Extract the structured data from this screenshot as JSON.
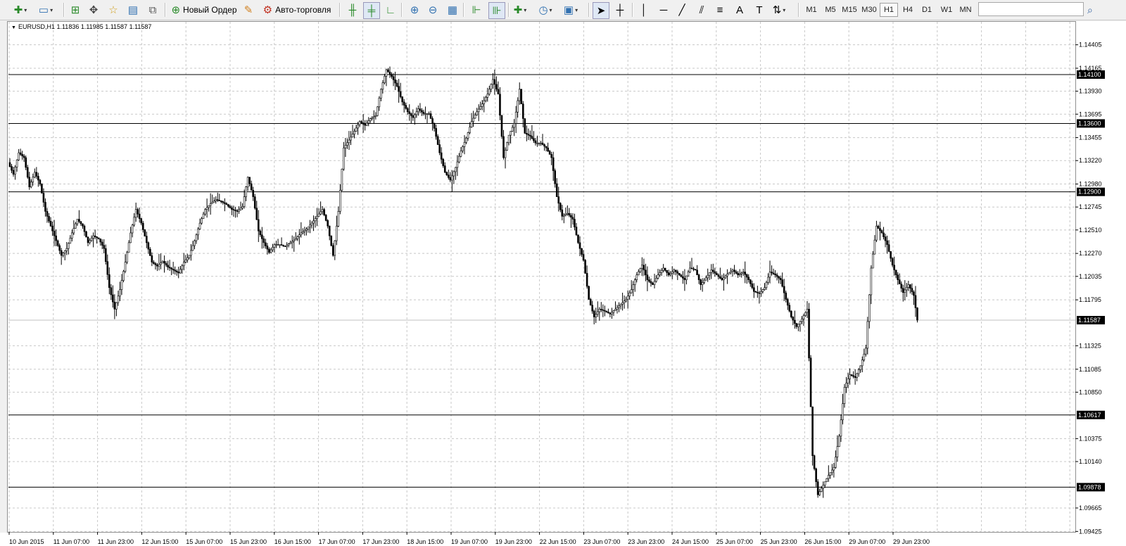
{
  "toolbar": {
    "new_order_label": "Новый Ордер",
    "autotrading_label": "Авто-торговля",
    "timeframes": [
      "M1",
      "M5",
      "M15",
      "M30",
      "H1",
      "H4",
      "D1",
      "W1",
      "MN"
    ],
    "active_timeframe": "H1",
    "search_placeholder": ""
  },
  "chart_header": {
    "symbol": "EURUSD,H1",
    "ohlc": "1.11836 1.11985 1.11587 1.11587"
  },
  "chart_data": {
    "type": "candlestick",
    "symbol": "EURUSD",
    "timeframe": "H1",
    "ylim": [
      1.0942,
      1.1464
    ],
    "y_ticks": [
      "1.14405",
      "1.14165",
      "1.13930",
      "1.13695",
      "1.13455",
      "1.13220",
      "1.12980",
      "1.12745",
      "1.12510",
      "1.12270",
      "1.12035",
      "1.11795",
      "1.11325",
      "1.11085",
      "1.10850",
      "1.10375",
      "1.10140",
      "1.09665",
      "1.09425"
    ],
    "x_labels": [
      "10 Jun 2015",
      "11 Jun 07:00",
      "11 Jun 23:00",
      "12 Jun 15:00",
      "15 Jun 07:00",
      "15 Jun 23:00",
      "16 Jun 15:00",
      "17 Jun 07:00",
      "17 Jun 23:00",
      "18 Jun 15:00",
      "19 Jun 07:00",
      "19 Jun 23:00",
      "22 Jun 15:00",
      "23 Jun 07:00",
      "23 Jun 23:00",
      "24 Jun 15:00",
      "25 Jun 07:00",
      "25 Jun 23:00",
      "26 Jun 15:00",
      "29 Jun 07:00",
      "29 Jun 23:00"
    ],
    "horizontal_levels": [
      1.141,
      1.136,
      1.129,
      1.10617,
      1.09878
    ],
    "horizontal_level_labels": [
      "1.14100",
      "1.13600",
      "1.12900",
      "1.10617",
      "1.09878"
    ],
    "current_price": 1.11587,
    "current_price_label": "1.11587",
    "price_path": [
      [
        0,
        1.132
      ],
      [
        3,
        1.1308
      ],
      [
        6,
        1.133
      ],
      [
        9,
        1.1325
      ],
      [
        12,
        1.1295
      ],
      [
        15,
        1.131
      ],
      [
        18,
        1.1298
      ],
      [
        21,
        1.127
      ],
      [
        24,
        1.1255
      ],
      [
        27,
        1.124
      ],
      [
        30,
        1.1225
      ],
      [
        33,
        1.1232
      ],
      [
        36,
        1.1248
      ],
      [
        39,
        1.1262
      ],
      [
        42,
        1.1255
      ],
      [
        45,
        1.1238
      ],
      [
        48,
        1.1245
      ],
      [
        51,
        1.1242
      ],
      [
        54,
        1.1232
      ],
      [
        57,
        1.1192
      ],
      [
        60,
        1.117
      ],
      [
        63,
        1.119
      ],
      [
        66,
        1.1218
      ],
      [
        69,
        1.1248
      ],
      [
        72,
        1.1272
      ],
      [
        75,
        1.1258
      ],
      [
        78,
        1.1238
      ],
      [
        81,
        1.1218
      ],
      [
        84,
        1.1214
      ],
      [
        87,
        1.1219
      ],
      [
        90,
        1.1213
      ],
      [
        93,
        1.121
      ],
      [
        96,
        1.1207
      ],
      [
        99,
        1.1218
      ],
      [
        102,
        1.1225
      ],
      [
        105,
        1.124
      ],
      [
        108,
        1.1258
      ],
      [
        111,
        1.1272
      ],
      [
        114,
        1.1278
      ],
      [
        117,
        1.1282
      ],
      [
        120,
        1.128
      ],
      [
        123,
        1.1277
      ],
      [
        126,
        1.1272
      ],
      [
        129,
        1.127
      ],
      [
        132,
        1.1275
      ],
      [
        135,
        1.1305
      ],
      [
        138,
        1.1285
      ],
      [
        141,
        1.125
      ],
      [
        144,
        1.1238
      ],
      [
        147,
        1.1228
      ],
      [
        150,
        1.1236
      ],
      [
        153,
        1.1236
      ],
      [
        156,
        1.1234
      ],
      [
        159,
        1.1238
      ],
      [
        162,
        1.1242
      ],
      [
        165,
        1.1248
      ],
      [
        168,
        1.1252
      ],
      [
        171,
        1.1258
      ],
      [
        174,
        1.1265
      ],
      [
        177,
        1.1272
      ],
      [
        180,
        1.1255
      ],
      [
        183,
        1.1225
      ],
      [
        186,
        1.127
      ],
      [
        189,
        1.1335
      ],
      [
        192,
        1.1343
      ],
      [
        195,
        1.1352
      ],
      [
        198,
        1.1362
      ],
      [
        201,
        1.1358
      ],
      [
        204,
        1.1365
      ],
      [
        207,
        1.1368
      ],
      [
        210,
        1.1395
      ],
      [
        213,
        1.1415
      ],
      [
        216,
        1.1408
      ],
      [
        219,
        1.1398
      ],
      [
        222,
        1.1382
      ],
      [
        225,
        1.1372
      ],
      [
        228,
        1.1366
      ],
      [
        231,
        1.1375
      ],
      [
        234,
        1.137
      ],
      [
        237,
        1.137
      ],
      [
        240,
        1.1355
      ],
      [
        243,
        1.133
      ],
      [
        246,
        1.131
      ],
      [
        249,
        1.1302
      ],
      [
        252,
        1.1315
      ],
      [
        255,
        1.1332
      ],
      [
        258,
        1.1345
      ],
      [
        261,
        1.1362
      ],
      [
        264,
        1.1372
      ],
      [
        267,
        1.138
      ],
      [
        270,
        1.139
      ],
      [
        273,
        1.1405
      ],
      [
        276,
        1.139
      ],
      [
        279,
        1.1325
      ],
      [
        282,
        1.1348
      ],
      [
        285,
        1.136
      ],
      [
        288,
        1.1395
      ],
      [
        291,
        1.135
      ],
      [
        294,
        1.1347
      ],
      [
        297,
        1.134
      ],
      [
        300,
        1.134
      ],
      [
        303,
        1.1335
      ],
      [
        306,
        1.1325
      ],
      [
        309,
        1.1285
      ],
      [
        312,
        1.1265
      ],
      [
        315,
        1.1268
      ],
      [
        318,
        1.1262
      ],
      [
        321,
        1.1238
      ],
      [
        324,
        1.122
      ],
      [
        327,
        1.118
      ],
      [
        330,
        1.1162
      ],
      [
        333,
        1.117
      ],
      [
        336,
        1.1168
      ],
      [
        339,
        1.1165
      ],
      [
        342,
        1.117
      ],
      [
        345,
        1.1175
      ],
      [
        348,
        1.118
      ],
      [
        351,
        1.119
      ],
      [
        354,
        1.1205
      ],
      [
        357,
        1.1215
      ],
      [
        360,
        1.12
      ],
      [
        363,
        1.1195
      ],
      [
        366,
        1.1205
      ],
      [
        369,
        1.1212
      ],
      [
        372,
        1.1205
      ],
      [
        375,
        1.121
      ],
      [
        378,
        1.1205
      ],
      [
        381,
        1.12
      ],
      [
        384,
        1.1212
      ],
      [
        387,
        1.121
      ],
      [
        390,
        1.1195
      ],
      [
        393,
        1.1202
      ],
      [
        396,
        1.121
      ],
      [
        399,
        1.1205
      ],
      [
        402,
        1.12
      ],
      [
        405,
        1.1206
      ],
      [
        408,
        1.121
      ],
      [
        411,
        1.1205
      ],
      [
        414,
        1.1208
      ],
      [
        417,
        1.12
      ],
      [
        420,
        1.1188
      ],
      [
        423,
        1.1186
      ],
      [
        426,
        1.1192
      ],
      [
        429,
        1.1208
      ],
      [
        432,
        1.1205
      ],
      [
        435,
        1.12
      ],
      [
        438,
        1.118
      ],
      [
        441,
        1.1162
      ],
      [
        444,
        1.1152
      ],
      [
        447,
        1.116
      ],
      [
        450,
        1.117
      ],
      [
        453,
        1.102
      ],
      [
        456,
        1.098
      ],
      [
        459,
        1.099
      ],
      [
        462,
        1.1
      ],
      [
        465,
        1.1008
      ],
      [
        468,
        1.104
      ],
      [
        471,
        1.109
      ],
      [
        474,
        1.1103
      ],
      [
        477,
        1.11
      ],
      [
        480,
        1.1112
      ],
      [
        483,
        1.113
      ],
      [
        486,
        1.1212
      ],
      [
        489,
        1.1255
      ],
      [
        492,
        1.1248
      ],
      [
        495,
        1.1236
      ],
      [
        498,
        1.1215
      ],
      [
        501,
        1.12
      ],
      [
        504,
        1.1187
      ],
      [
        507,
        1.1195
      ],
      [
        510,
        1.1184
      ],
      [
        512,
        1.11587
      ]
    ]
  }
}
